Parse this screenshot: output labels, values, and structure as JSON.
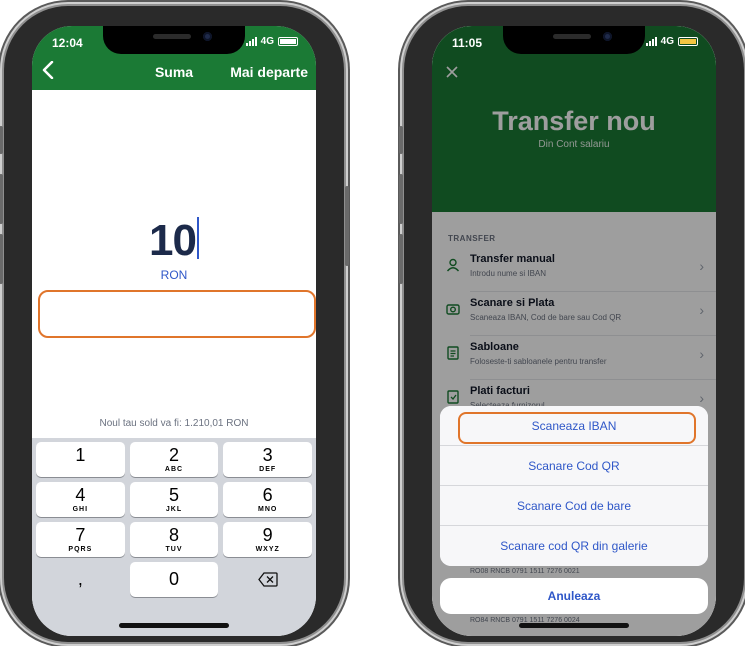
{
  "left_phone": {
    "status": {
      "time": "12:04",
      "network": "4G"
    },
    "header": {
      "back_icon": "chevron-left-icon",
      "title": "Suma",
      "next_label": "Mai departe"
    },
    "amount": "10",
    "currency": "RON",
    "new_balance": "Noul tau sold va fi: 1.210,01 RON",
    "keypad": {
      "rows": [
        [
          {
            "digit": "1",
            "letters": ""
          },
          {
            "digit": "2",
            "letters": "ABC"
          },
          {
            "digit": "3",
            "letters": "DEF"
          }
        ],
        [
          {
            "digit": "4",
            "letters": "GHI"
          },
          {
            "digit": "5",
            "letters": "JKL"
          },
          {
            "digit": "6",
            "letters": "MNO"
          }
        ],
        [
          {
            "digit": "7",
            "letters": "PQRS"
          },
          {
            "digit": "8",
            "letters": "TUV"
          },
          {
            "digit": "9",
            "letters": "WXYZ"
          }
        ]
      ],
      "bottom": {
        "decimal": ",",
        "zero": "0",
        "delete_icon": "backspace-icon"
      }
    },
    "highlight_color": "#e0752b",
    "header_color": "#1b7a35"
  },
  "right_phone": {
    "status": {
      "time": "11:05",
      "network": "4G"
    },
    "close_icon": "close-icon",
    "title": "Transfer nou",
    "subtitle": "Din Cont salariu",
    "section_label": "TRANSFER",
    "items": [
      {
        "icon": "person-icon",
        "title": "Transfer manual",
        "subtitle": "Introdu nume si IBAN"
      },
      {
        "icon": "camera-icon",
        "title": "Scanare si Plata",
        "subtitle": "Scaneaza IBAN, Cod de bare sau Cod QR"
      },
      {
        "icon": "document-icon",
        "title": "Sabloane",
        "subtitle": "Foloseste-ti sabloanele pentru transfer"
      },
      {
        "icon": "invoice-icon",
        "title": "Plati facturi",
        "subtitle": "Selecteaza furnizorul"
      }
    ],
    "accounts": [
      "RO08 RNCB 0791 1511 7276 0021",
      "RO84 RNCB 0791 1511 7276 0024"
    ],
    "sheet_options": [
      "Scaneaza IBAN",
      "Scanare Cod QR",
      "Scanare Cod de bare",
      "Scanare cod QR din galerie"
    ],
    "cancel_label": "Anuleaza",
    "accent_color": "#2f57c8"
  }
}
